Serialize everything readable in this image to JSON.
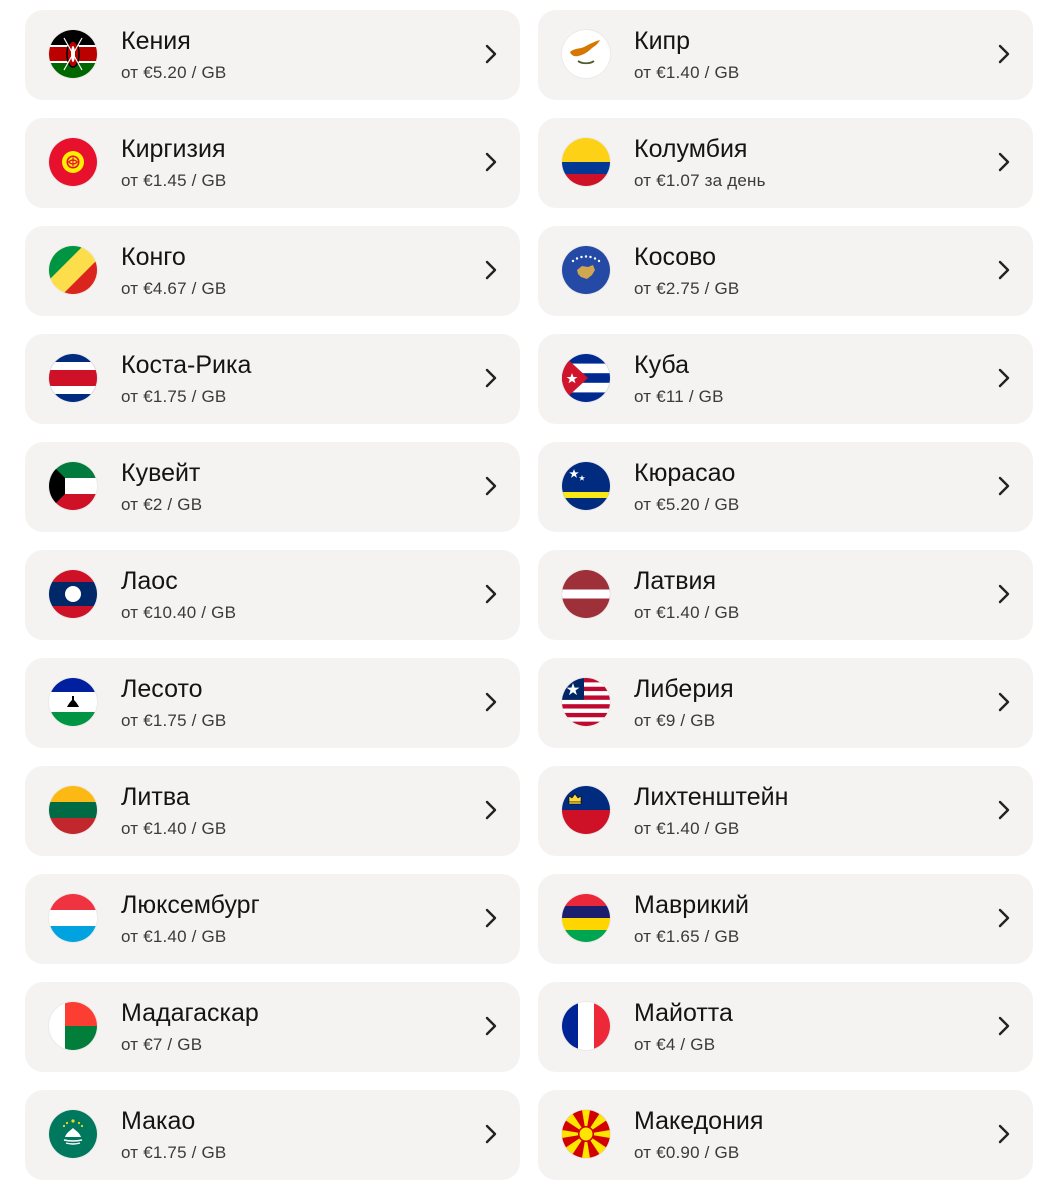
{
  "countries": [
    {
      "name": "Кения",
      "price": "от €5.20 / GB",
      "flag": "kenya-flag-icon"
    },
    {
      "name": "Кипр",
      "price": "от €1.40 / GB",
      "flag": "cyprus-flag-icon"
    },
    {
      "name": "Киргизия",
      "price": "от €1.45 / GB",
      "flag": "kyrgyzstan-flag-icon"
    },
    {
      "name": "Колумбия",
      "price": "от €1.07 за день",
      "flag": "colombia-flag-icon"
    },
    {
      "name": "Конго",
      "price": "от €4.67 / GB",
      "flag": "congo-flag-icon"
    },
    {
      "name": "Косово",
      "price": "от €2.75 / GB",
      "flag": "kosovo-flag-icon"
    },
    {
      "name": "Коста-Рика",
      "price": "от €1.75 / GB",
      "flag": "costa-rica-flag-icon"
    },
    {
      "name": "Куба",
      "price": "от €11 / GB",
      "flag": "cuba-flag-icon"
    },
    {
      "name": "Кувейт",
      "price": "от €2 / GB",
      "flag": "kuwait-flag-icon"
    },
    {
      "name": "Кюрасао",
      "price": "от €5.20 / GB",
      "flag": "curacao-flag-icon"
    },
    {
      "name": "Лаос",
      "price": "от €10.40 / GB",
      "flag": "laos-flag-icon"
    },
    {
      "name": "Латвия",
      "price": "от €1.40 / GB",
      "flag": "latvia-flag-icon"
    },
    {
      "name": "Лесото",
      "price": "от €1.75 / GB",
      "flag": "lesotho-flag-icon"
    },
    {
      "name": "Либерия",
      "price": "от €9 / GB",
      "flag": "liberia-flag-icon"
    },
    {
      "name": "Литва",
      "price": "от €1.40 / GB",
      "flag": "lithuania-flag-icon"
    },
    {
      "name": "Лихтенштейн",
      "price": "от €1.40 / GB",
      "flag": "liechtenstein-flag-icon"
    },
    {
      "name": "Люксембург",
      "price": "от €1.40 / GB",
      "flag": "luxembourg-flag-icon"
    },
    {
      "name": "Маврикий",
      "price": "от €1.65 / GB",
      "flag": "mauritius-flag-icon"
    },
    {
      "name": "Мадагаскар",
      "price": "от €7 / GB",
      "flag": "madagascar-flag-icon"
    },
    {
      "name": "Майотта",
      "price": "от €4 / GB",
      "flag": "mayotte-flag-icon"
    },
    {
      "name": "Макао",
      "price": "от €1.75 / GB",
      "flag": "macau-flag-icon"
    },
    {
      "name": "Македония",
      "price": "от €0.90 / GB",
      "flag": "macedonia-flag-icon"
    }
  ],
  "colors": {
    "card_background": "#f4f3f1",
    "text_primary": "#141414",
    "text_secondary": "#3a3a3a"
  }
}
